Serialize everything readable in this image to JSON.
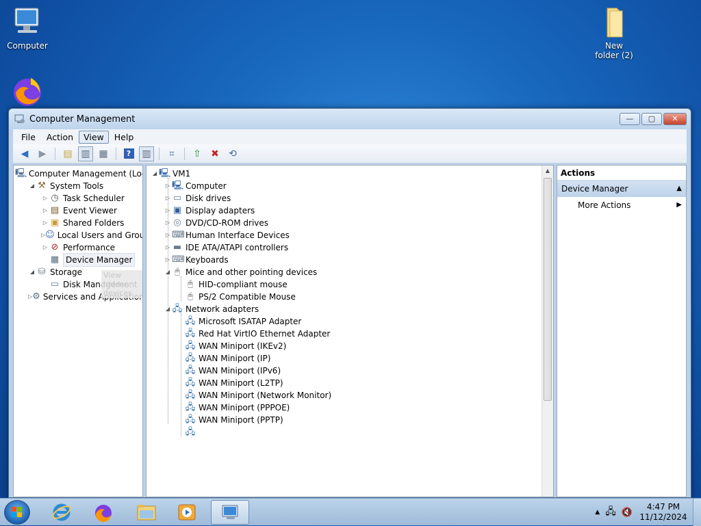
{
  "desktop": {
    "icons": [
      {
        "label": "Computer",
        "icon": "computer-icon"
      },
      {
        "label": "New folder (2)",
        "icon": "folder-icon"
      },
      {
        "label": "",
        "icon": "firefox-icon"
      }
    ]
  },
  "window": {
    "title": "Computer Management",
    "controls": {
      "minimize": "minimize-icon",
      "maximize": "maximize-icon",
      "close": "close-icon"
    },
    "menu": [
      "File",
      "Action",
      "View",
      "Help"
    ],
    "active_menu": "View",
    "tooltip": "View hidden devices"
  },
  "left_tree": [
    {
      "label": "Computer Management (Local",
      "level": 0,
      "expander": "",
      "icon": "computer-management-icon"
    },
    {
      "label": "System Tools",
      "level": 1,
      "expander": "expanded",
      "icon": "tools-icon"
    },
    {
      "label": "Task Scheduler",
      "level": 2,
      "expander": "collapsed",
      "icon": "clock-icon"
    },
    {
      "label": "Event Viewer",
      "level": 2,
      "expander": "collapsed",
      "icon": "event-viewer-icon"
    },
    {
      "label": "Shared Folders",
      "level": 2,
      "expander": "collapsed",
      "icon": "shared-folder-icon"
    },
    {
      "label": "Local Users and Groups",
      "level": 2,
      "expander": "collapsed",
      "icon": "users-icon"
    },
    {
      "label": "Performance",
      "level": 2,
      "expander": "collapsed",
      "icon": "performance-icon"
    },
    {
      "label": "Device Manager",
      "level": 2,
      "expander": "",
      "icon": "device-manager-icon",
      "selected": true
    },
    {
      "label": "Storage",
      "level": 1,
      "expander": "expanded",
      "icon": "storage-icon"
    },
    {
      "label": "Disk Management",
      "level": 2,
      "expander": "",
      "icon": "disk-icon"
    },
    {
      "label": "Services and Applications",
      "level": 1,
      "expander": "collapsed",
      "icon": "services-icon"
    }
  ],
  "device_tree": [
    {
      "label": "VM1",
      "level": 0,
      "expander": "expanded",
      "icon": "computer-icon"
    },
    {
      "label": "Computer",
      "level": 1,
      "expander": "collapsed",
      "icon": "computer-icon"
    },
    {
      "label": "Disk drives",
      "level": 1,
      "expander": "collapsed",
      "icon": "disk-drive-icon"
    },
    {
      "label": "Display adapters",
      "level": 1,
      "expander": "collapsed",
      "icon": "display-adapter-icon"
    },
    {
      "label": "DVD/CD-ROM drives",
      "level": 1,
      "expander": "collapsed",
      "icon": "dvd-icon"
    },
    {
      "label": "Human Interface Devices",
      "level": 1,
      "expander": "collapsed",
      "icon": "hid-icon"
    },
    {
      "label": "IDE ATA/ATAPI controllers",
      "level": 1,
      "expander": "collapsed",
      "icon": "ide-icon"
    },
    {
      "label": "Keyboards",
      "level": 1,
      "expander": "collapsed",
      "icon": "keyboard-icon"
    },
    {
      "label": "Mice and other pointing devices",
      "level": 1,
      "expander": "expanded",
      "icon": "mouse-icon"
    },
    {
      "label": "HID-compliant mouse",
      "level": 2,
      "expander": "",
      "icon": "mouse-icon"
    },
    {
      "label": "PS/2 Compatible Mouse",
      "level": 2,
      "expander": "",
      "icon": "mouse-icon"
    },
    {
      "label": "Network adapters",
      "level": 1,
      "expander": "expanded",
      "icon": "network-icon"
    },
    {
      "label": "Microsoft ISATAP Adapter",
      "level": 2,
      "expander": "",
      "icon": "network-icon"
    },
    {
      "label": "Red Hat VirtIO Ethernet Adapter",
      "level": 2,
      "expander": "",
      "icon": "network-icon"
    },
    {
      "label": "WAN Miniport (IKEv2)",
      "level": 2,
      "expander": "",
      "icon": "network-icon"
    },
    {
      "label": "WAN Miniport (IP)",
      "level": 2,
      "expander": "",
      "icon": "network-icon"
    },
    {
      "label": "WAN Miniport (IPv6)",
      "level": 2,
      "expander": "",
      "icon": "network-icon"
    },
    {
      "label": "WAN Miniport (L2TP)",
      "level": 2,
      "expander": "",
      "icon": "network-icon"
    },
    {
      "label": "WAN Miniport (Network Monitor)",
      "level": 2,
      "expander": "",
      "icon": "network-icon"
    },
    {
      "label": "WAN Miniport (PPPOE)",
      "level": 2,
      "expander": "",
      "icon": "network-icon"
    },
    {
      "label": "WAN Miniport (PPTP)",
      "level": 2,
      "expander": "",
      "icon": "network-icon"
    },
    {
      "label": "",
      "level": 2,
      "expander": "",
      "icon": "network-icon"
    }
  ],
  "actions": {
    "header": "Actions",
    "section": "Device Manager",
    "items": [
      "More Actions"
    ]
  },
  "taskbar": {
    "apps": [
      "start-button",
      "internet-explorer-icon",
      "firefox-icon",
      "file-explorer-icon",
      "media-player-icon",
      "computer-management-icon"
    ],
    "time": "4:47 PM",
    "date": "11/12/2024"
  }
}
